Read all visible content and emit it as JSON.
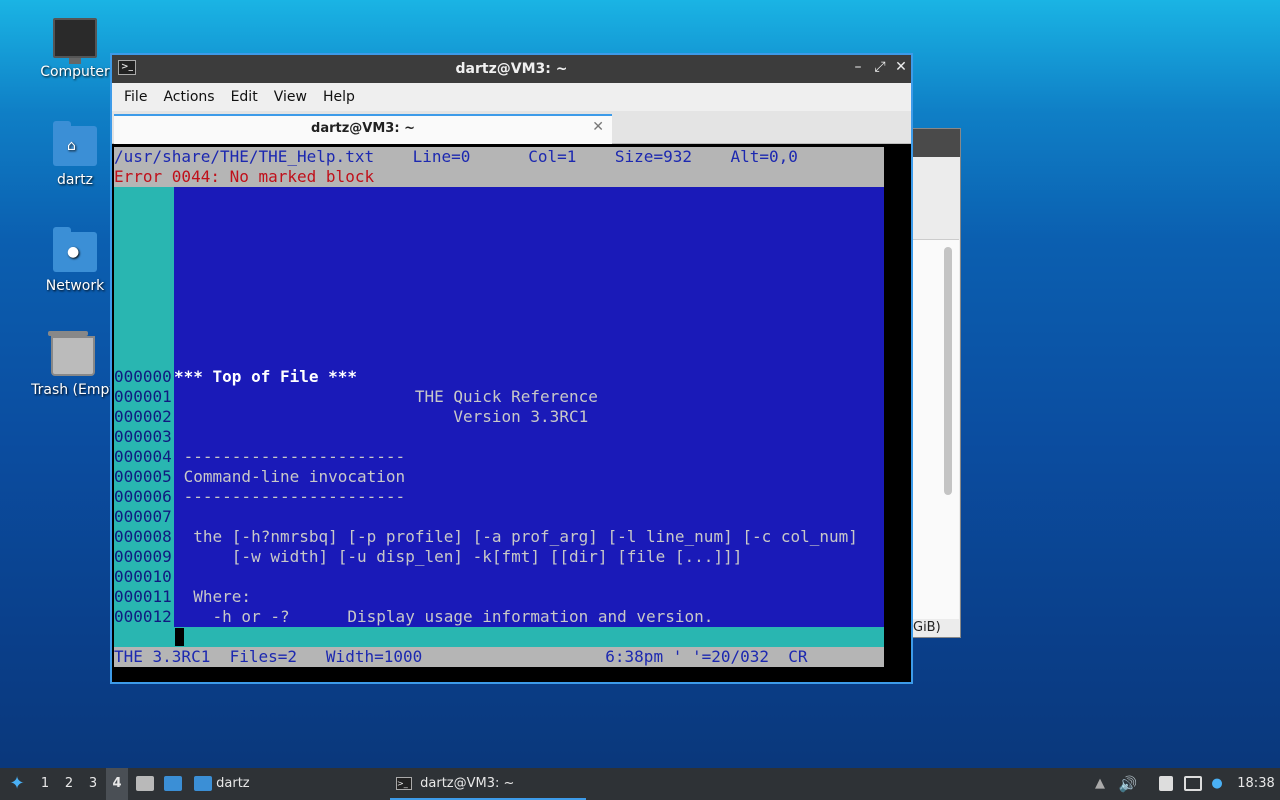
{
  "desktop": {
    "icons": [
      {
        "label": "Computer"
      },
      {
        "label": "dartz"
      },
      {
        "label": "Network"
      },
      {
        "label": "Trash (Empt"
      }
    ]
  },
  "bg_window": {
    "text": "GiB)"
  },
  "window": {
    "title": "dartz@VM3: ~",
    "controls": {
      "minimize": "–",
      "maximize": "⤢",
      "close": "✕"
    },
    "menu": [
      "File",
      "Actions",
      "Edit",
      "View",
      "Help"
    ],
    "tab": {
      "label": "dartz@VM3: ~",
      "close": "✕"
    }
  },
  "editor": {
    "status_line": "/usr/share/THE/THE_Help.txt    Line=0      Col=1    Size=932    Alt=0,0",
    "error_line": "Error 0044: No marked block",
    "lines": [
      {
        "prefix": "000000",
        "text": "*** Top of File ***"
      },
      {
        "prefix": "000001",
        "text": "                         THE Quick Reference"
      },
      {
        "prefix": "000002",
        "text": "                             Version 3.3RC1"
      },
      {
        "prefix": "000003",
        "text": ""
      },
      {
        "prefix": "000004",
        "text": " -----------------------"
      },
      {
        "prefix": "000005",
        "text": " Command-line invocation"
      },
      {
        "prefix": "000006",
        "text": " -----------------------"
      },
      {
        "prefix": "000007",
        "text": ""
      },
      {
        "prefix": "000008",
        "text": "  the [-h?nmrsbq] [-p profile] [-a prof_arg] [-l line_num] [-c col_num]"
      },
      {
        "prefix": "000009",
        "text": "      [-w width] [-u disp_len] -k[fmt] [[dir] [file [...]]]"
      },
      {
        "prefix": "000010",
        "text": ""
      },
      {
        "prefix": "000011",
        "text": "  Where:"
      },
      {
        "prefix": "000012",
        "text": "    -h or -?      Display usage information and version."
      }
    ],
    "command_prompt": "====>",
    "bottom_status": "THE 3.3RC1  Files=2   Width=1000                   6:38pm ' '=20/032  CR"
  },
  "taskbar": {
    "workspaces": [
      "1",
      "2",
      "3",
      "4"
    ],
    "active_workspace": "4",
    "folder_label": "dartz",
    "task_label": "dartz@VM3: ~",
    "clock": "18:38"
  }
}
